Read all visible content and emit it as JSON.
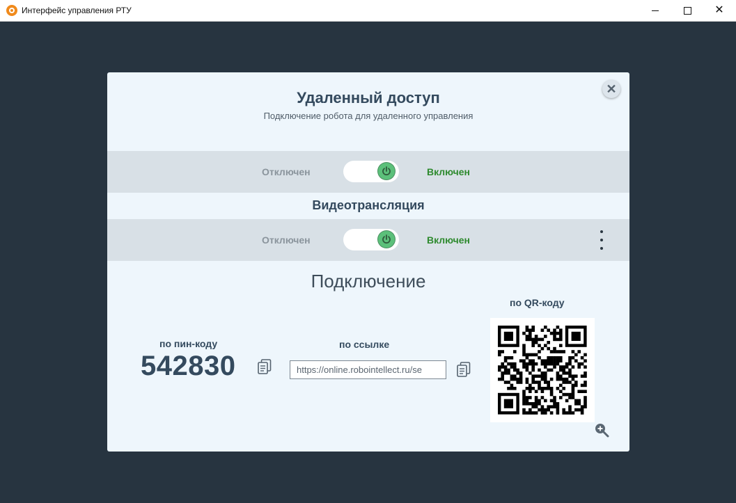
{
  "window": {
    "title": "Интерфейс управления РТУ",
    "app_icon": "app-logo-icon"
  },
  "dialog": {
    "title": "Удаленный доступ",
    "subtitle": "Подключение робота для удаленного управления",
    "close_icon": "close-icon"
  },
  "remote_access": {
    "off_label": "Отключен",
    "on_label": "Включен",
    "enabled": true
  },
  "video": {
    "section_title": "Видеотрансляция",
    "off_label": "Отключен",
    "on_label": "Включен",
    "enabled": true
  },
  "connection": {
    "title": "Подключение",
    "pin_label": "по пин-коду",
    "pin_value": "542830",
    "link_label": "по ссылке",
    "link_value": "https://online.robointellect.ru/se",
    "qr_label": "по QR-коду"
  },
  "colors": {
    "workspace_bg": "#273440",
    "dialog_bg": "#eef6fc",
    "band_bg": "#d8e0e6",
    "on_green": "#2e8a2e",
    "title_text": "#344a5e"
  }
}
